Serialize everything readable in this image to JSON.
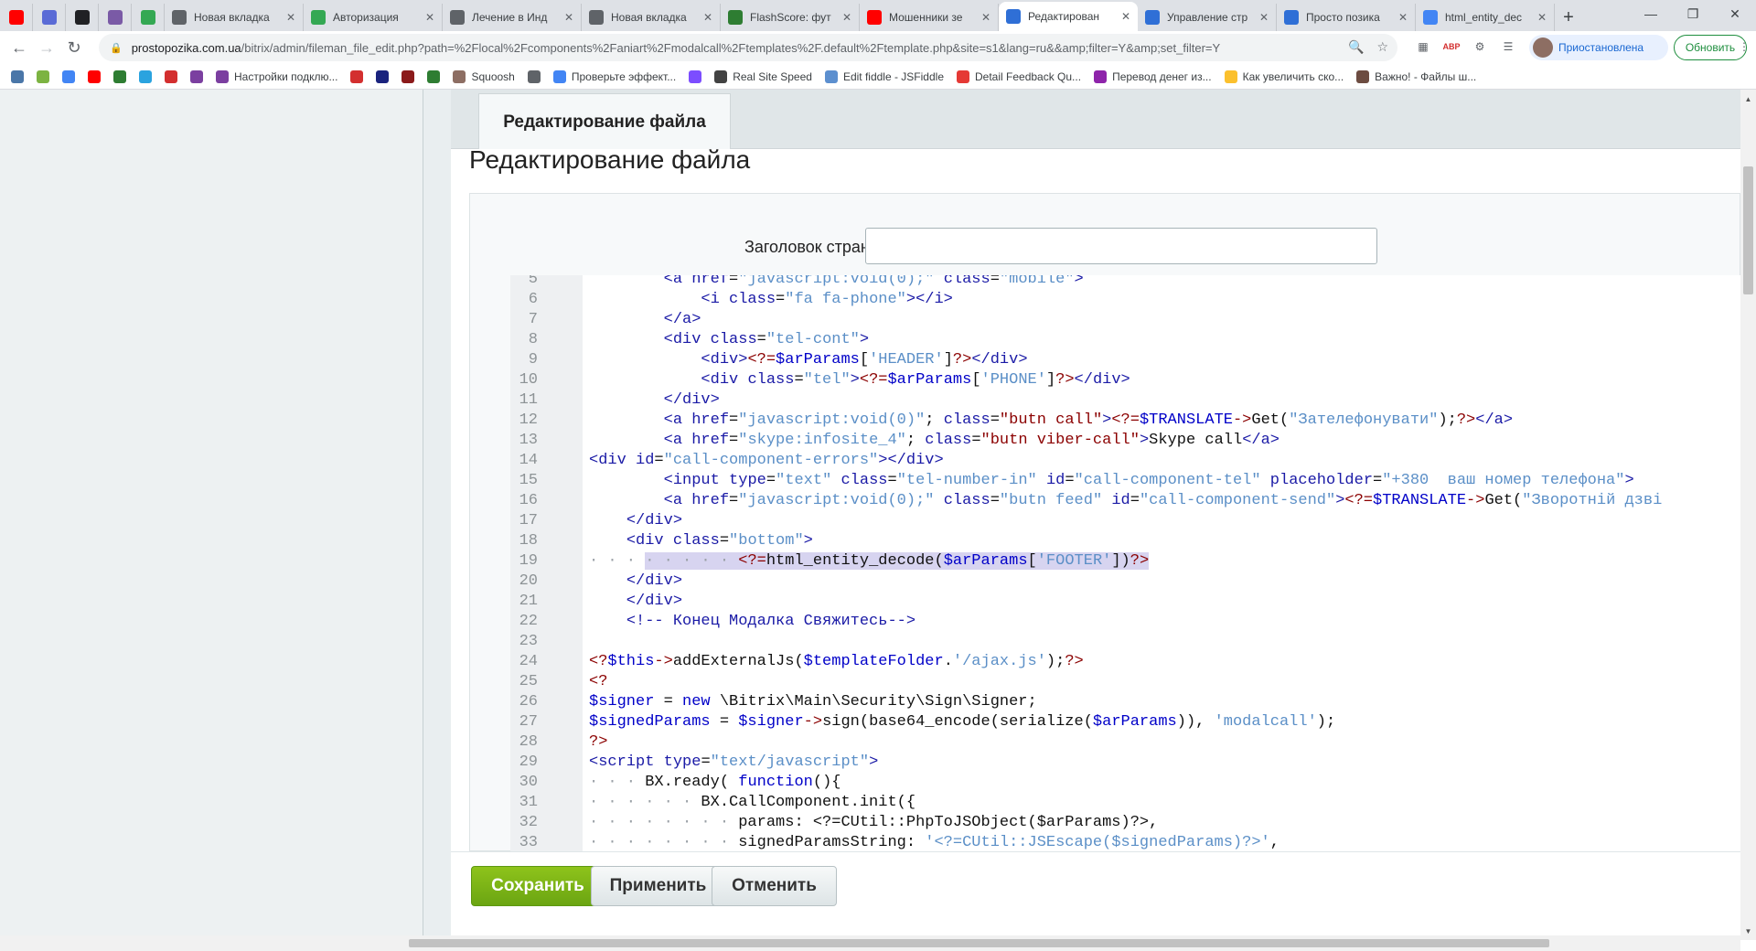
{
  "browser": {
    "tabs": [
      {
        "title": "",
        "icon": "youtube-icon",
        "color": "#ff0000",
        "pinned": true
      },
      {
        "title": "",
        "icon": "chart-icon",
        "color": "#5a6bd6",
        "pinned": true
      },
      {
        "title": "",
        "icon": "info-icon",
        "color": "#202124",
        "pinned": true
      },
      {
        "title": "",
        "icon": "wave-icon",
        "color": "#7a5aa6",
        "pinned": true
      },
      {
        "title": "",
        "icon": "bar-icon",
        "color": "#34a853",
        "pinned": true
      },
      {
        "title": "Новая вкладка",
        "icon": "newtab-icon",
        "color": "#5f6368",
        "pinned": false
      },
      {
        "title": "Авторизация",
        "icon": "slash-icon",
        "color": "#34a853",
        "pinned": false
      },
      {
        "title": "Лечение в Инд",
        "icon": "cloud-icon",
        "color": "#5f6368",
        "pinned": false
      },
      {
        "title": "Новая вкладка",
        "icon": "newtab-icon",
        "color": "#5f6368",
        "pinned": false
      },
      {
        "title": "FlashScore: фут",
        "icon": "flashscore-icon",
        "color": "#2e7d32",
        "pinned": false
      },
      {
        "title": "Мошенники зе",
        "icon": "youtube-icon",
        "color": "#ff0000",
        "pinned": false
      },
      {
        "title": "Редактирован",
        "icon": "bitrix-icon",
        "color": "#2f6fd6",
        "pinned": false,
        "active": true
      },
      {
        "title": "Управление стр",
        "icon": "bitrix-icon",
        "color": "#2f6fd6",
        "pinned": false
      },
      {
        "title": "Просто позика",
        "icon": "bitrix-icon",
        "color": "#2f6fd6",
        "pinned": false
      },
      {
        "title": "html_entity_dec",
        "icon": "google-icon",
        "color": "#4285f4",
        "pinned": false
      }
    ],
    "url_domain": "prostopozika.com.ua",
    "url_rest": "/bitrix/admin/fileman_file_edit.php?path=%2Flocal%2Fcomponents%2Faniart%2Fmodalcall%2Ftemplates%2F.default%2Ftemplate.php&site=s1&lang=ru&&amp;filter=Y&amp;set_filter=Y",
    "profile_label": "Приостановлена",
    "update_label": "Обновить"
  },
  "bookmarks": [
    {
      "label": "",
      "icon": "vk-icon",
      "color": "#4a76a8"
    },
    {
      "label": "",
      "icon": "a-icon",
      "color": "#7cb342"
    },
    {
      "label": "",
      "icon": "translate-icon",
      "color": "#4285f4"
    },
    {
      "label": "",
      "icon": "youtube-icon",
      "color": "#ff0000"
    },
    {
      "label": "",
      "icon": "f-icon",
      "color": "#2e7d32"
    },
    {
      "label": "",
      "icon": "telegram-icon",
      "color": "#2aa3df"
    },
    {
      "label": "",
      "icon": "thermo-icon",
      "color": "#d32f2f"
    },
    {
      "label": "",
      "icon": "ua-icon",
      "color": "#7b3fa0"
    },
    {
      "label": "Настройки подклю...",
      "icon": "ua-icon",
      "color": "#7b3fa0"
    },
    {
      "label": "",
      "icon": "live-icon",
      "color": "#d32f2f"
    },
    {
      "label": "",
      "icon": "vp-icon",
      "color": "#1a237e"
    },
    {
      "label": "",
      "icon": "game-icon",
      "color": "#8b1a1a"
    },
    {
      "label": "",
      "icon": "box-icon",
      "color": "#2e7d32"
    },
    {
      "label": "Squoosh",
      "icon": "squoosh-icon",
      "color": "#8d6e63"
    },
    {
      "label": "",
      "icon": "code-icon",
      "color": "#5f6368"
    },
    {
      "label": "Проверьте эффект...",
      "icon": "google-icon",
      "color": "#4285f4"
    },
    {
      "label": "",
      "icon": "feather-icon",
      "color": "#7c4dff"
    },
    {
      "label": "Real Site Speed",
      "icon": "speed-icon",
      "color": "#424242"
    },
    {
      "label": "Edit fiddle - JSFiddle",
      "icon": "cloud-icon",
      "color": "#5c8fcf"
    },
    {
      "label": "Detail Feedback Qu...",
      "icon": "mail-icon",
      "color": "#e53935"
    },
    {
      "label": "Перевод денег из...",
      "icon": "ps-icon",
      "color": "#8e24aa"
    },
    {
      "label": "Как увеличить ско...",
      "icon": "leaf-icon",
      "color": "#fbc02d"
    },
    {
      "label": "Важно! - Файлы ш...",
      "icon": "cart-icon",
      "color": "#6d4c41"
    }
  ],
  "page": {
    "tab_label": "Редактирование файла",
    "title": "Редактирование файла",
    "header_label": "Заголовок страницы:",
    "header_value": "",
    "save_label": "Сохранить",
    "apply_label": "Применить",
    "cancel_label": "Отменить"
  },
  "code_lines": [
    {
      "n": "5",
      "html": "        <span class=\"tg\">&lt;a</span> <span class=\"at\">href</span>=<span class=\"st\">\"javascript:void(0);\"</span> <span class=\"at\">class</span>=<span class=\"st\">\"mobile\"</span><span class=\"tg\">&gt;</span>"
    },
    {
      "n": "6",
      "html": "            <span class=\"tg\">&lt;i</span> <span class=\"at\">class</span>=<span class=\"st\">\"fa fa-phone\"</span><span class=\"tg\">&gt;&lt;/i&gt;</span>"
    },
    {
      "n": "7",
      "html": "        <span class=\"tg\">&lt;/a&gt;</span>"
    },
    {
      "n": "8",
      "html": "        <span class=\"tg\">&lt;div</span> <span class=\"at\">class</span>=<span class=\"st\">\"tel-cont\"</span><span class=\"tg\">&gt;</span>"
    },
    {
      "n": "9",
      "html": "            <span class=\"tg\">&lt;div&gt;</span><span class=\"ph\">&lt;?=</span><span class=\"vr\">$arParams</span>[<span class=\"st\">'HEADER'</span>]<span class=\"ph\">?&gt;</span><span class=\"tg\">&lt;/div&gt;</span>"
    },
    {
      "n": "10",
      "html": "            <span class=\"tg\">&lt;div</span> <span class=\"at\">class</span>=<span class=\"st\">\"tel\"</span><span class=\"tg\">&gt;</span><span class=\"ph\">&lt;?=</span><span class=\"vr\">$arParams</span>[<span class=\"st\">'PHONE'</span>]<span class=\"ph\">?&gt;</span><span class=\"tg\">&lt;/div&gt;</span>"
    },
    {
      "n": "11",
      "html": "        <span class=\"tg\">&lt;/div&gt;</span>"
    },
    {
      "n": "12",
      "html": "        <span class=\"tg\">&lt;a</span> <span class=\"at\">href</span>=<span class=\"st\">\"javascript:void(0)\"</span>; <span class=\"at\">class</span>=<span class=\"ph\">\"butn call\"</span><span class=\"tg\">&gt;</span><span class=\"ph\">&lt;?=</span><span class=\"vr\">$TRANSLATE</span><span class=\"ph\">-&gt;</span>Get(<span class=\"st\">\"Зателефонувати\"</span>);<span class=\"ph\">?&gt;</span><span class=\"tg\">&lt;/a&gt;</span>"
    },
    {
      "n": "13",
      "html": "        <span class=\"tg\">&lt;a</span> <span class=\"at\">href</span>=<span class=\"st\">\"skype:infosite_4\"</span>; <span class=\"at\">class</span>=<span class=\"ph\">\"butn viber-call\"</span><span class=\"tg\">&gt;</span>Skype call<span class=\"tg\">&lt;/a&gt;</span>"
    },
    {
      "n": "14",
      "html": "<span class=\"tg\">&lt;div</span> <span class=\"at\">id</span>=<span class=\"st\">\"call-component-errors\"</span><span class=\"tg\">&gt;&lt;/div&gt;</span>"
    },
    {
      "n": "15",
      "html": "        <span class=\"tg\">&lt;input</span> <span class=\"at\">type</span>=<span class=\"st\">\"text\"</span> <span class=\"at\">class</span>=<span class=\"st\">\"tel-number-in\"</span> <span class=\"at\">id</span>=<span class=\"st\">\"call-component-tel\"</span> <span class=\"at\">placeholder</span>=<span class=\"st\">\"+380  ваш номер телефона\"</span><span class=\"tg\">&gt;</span>"
    },
    {
      "n": "16",
      "html": "        <span class=\"tg\">&lt;a</span> <span class=\"at\">href</span>=<span class=\"st\">\"javascript:void(0);\"</span> <span class=\"at\">class</span>=<span class=\"st\">\"butn feed\"</span> <span class=\"at\">id</span>=<span class=\"st\">\"call-component-send\"</span><span class=\"tg\">&gt;</span><span class=\"ph\">&lt;?=</span><span class=\"vr\">$TRANSLATE</span><span class=\"ph\">-&gt;</span>Get(<span class=\"st\">\"Зворотній дзві</span>"
    },
    {
      "n": "17",
      "html": "    <span class=\"tg\">&lt;/div&gt;</span>"
    },
    {
      "n": "18",
      "html": "    <span class=\"tg\">&lt;div</span> <span class=\"at\">class</span>=<span class=\"st\">\"bottom\"</span><span class=\"tg\">&gt;</span>"
    },
    {
      "n": "19",
      "html": "<span class=\"dots\">· · · </span><span class=\"hlbg\"><span class=\"dots\">· · · · · </span><span class=\"ph\">&lt;?=</span>html_entity_decode(<span class=\"vr\">$arParams</span>[<span class=\"st\">'FOOTER'</span>])<span class=\"ph\">?&gt;</span></span>",
      "hl": true
    },
    {
      "n": "20",
      "html": "    <span class=\"tg\">&lt;/div&gt;</span>"
    },
    {
      "n": "21",
      "html": "<span class=\"tg\">    &lt;/div&gt;</span>"
    },
    {
      "n": "22",
      "html": "    <span class=\"cm\">&lt;!-- Конец Модалка Свяжитесь--&gt;</span>"
    },
    {
      "n": "23",
      "html": ""
    },
    {
      "n": "24",
      "html": "<span class=\"ph\">&lt;?</span><span class=\"vr\">$this</span><span class=\"ph\">-&gt;</span>addExternalJs(<span class=\"vr\">$templateFolder</span>.<span class=\"st\">'/ajax.js'</span>);<span class=\"ph\">?&gt;</span>"
    },
    {
      "n": "25",
      "html": "<span class=\"ph\">&lt;?</span>"
    },
    {
      "n": "26",
      "html": "<span class=\"vr\">$signer</span> = <span class=\"vr\">new</span> \\Bitrix\\Main\\Security\\Sign\\Signer;"
    },
    {
      "n": "27",
      "html": "<span class=\"vr\">$signedParams</span> = <span class=\"vr\">$signer</span><span class=\"ph\">-&gt;</span>sign(base64_encode(serialize(<span class=\"vr\">$arParams</span>)), <span class=\"st\">'modalcall'</span>);"
    },
    {
      "n": "28",
      "html": "<span class=\"ph\">?&gt;</span>"
    },
    {
      "n": "29",
      "html": "<span class=\"tg\">&lt;script</span> <span class=\"at\">type</span>=<span class=\"st\">\"text/javascript\"</span><span class=\"tg\">&gt;</span>"
    },
    {
      "n": "30",
      "html": "<span class=\"dots\">· · · </span>BX.ready( <span class=\"vr\">function</span>(){"
    },
    {
      "n": "31",
      "html": "<span class=\"dots\">· · · · · · </span>BX.CallComponent.init({"
    },
    {
      "n": "32",
      "html": "<span class=\"dots\">· · · · · · · · </span>params: &lt;?=CUtil::PhpToJSObject($arParams)?&gt;,"
    },
    {
      "n": "33",
      "html": "<span class=\"dots\">· · · · · · · · </span>signedParamsString: <span class=\"st\">'&lt;?=CUtil::JSEscape($signedParams)?&gt;'</span>,"
    }
  ]
}
